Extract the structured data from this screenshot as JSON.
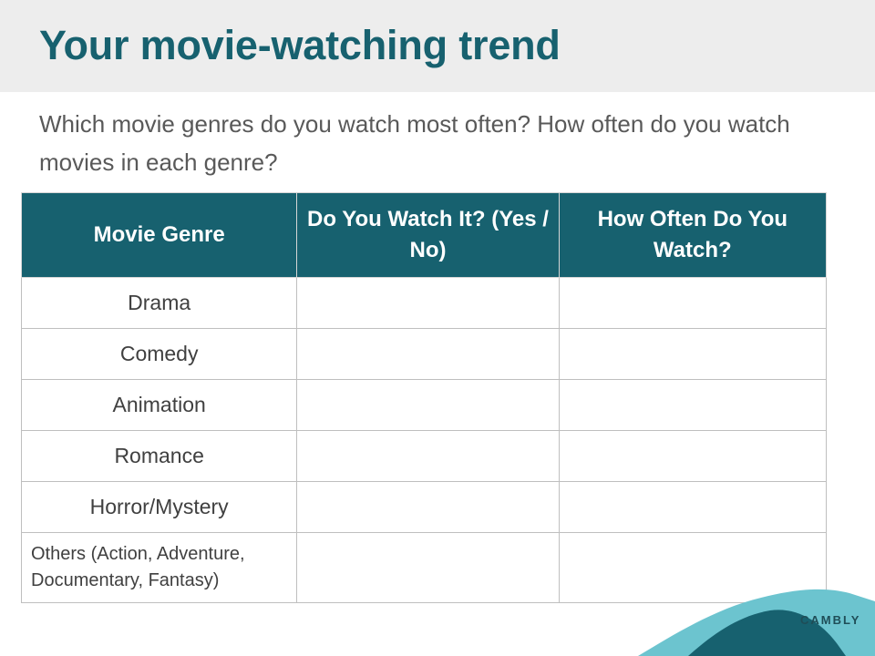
{
  "slide": {
    "title": "Your movie-watching trend",
    "prompt": "Which movie genres do you watch most often? How often do you watch movies in each genre?"
  },
  "table": {
    "headers": {
      "genre": "Movie Genre",
      "watch": "Do You Watch It? (Yes / No)",
      "often": "How Often Do You Watch?"
    },
    "rows": [
      {
        "genre": "Drama",
        "watch": "",
        "often": ""
      },
      {
        "genre": "Comedy",
        "watch": "",
        "often": ""
      },
      {
        "genre": "Animation",
        "watch": "",
        "often": ""
      },
      {
        "genre": "Romance",
        "watch": "",
        "often": ""
      },
      {
        "genre": "Horror/Mystery",
        "watch": "",
        "often": ""
      },
      {
        "genre": "Others (Action, Adventure, Documentary, Fantasy)",
        "watch": "",
        "often": ""
      }
    ]
  },
  "brand": {
    "name": "CAMBLY",
    "colors": {
      "dark": "#17616f",
      "light": "#6cc4cf",
      "title_bar": "#ededed"
    }
  }
}
